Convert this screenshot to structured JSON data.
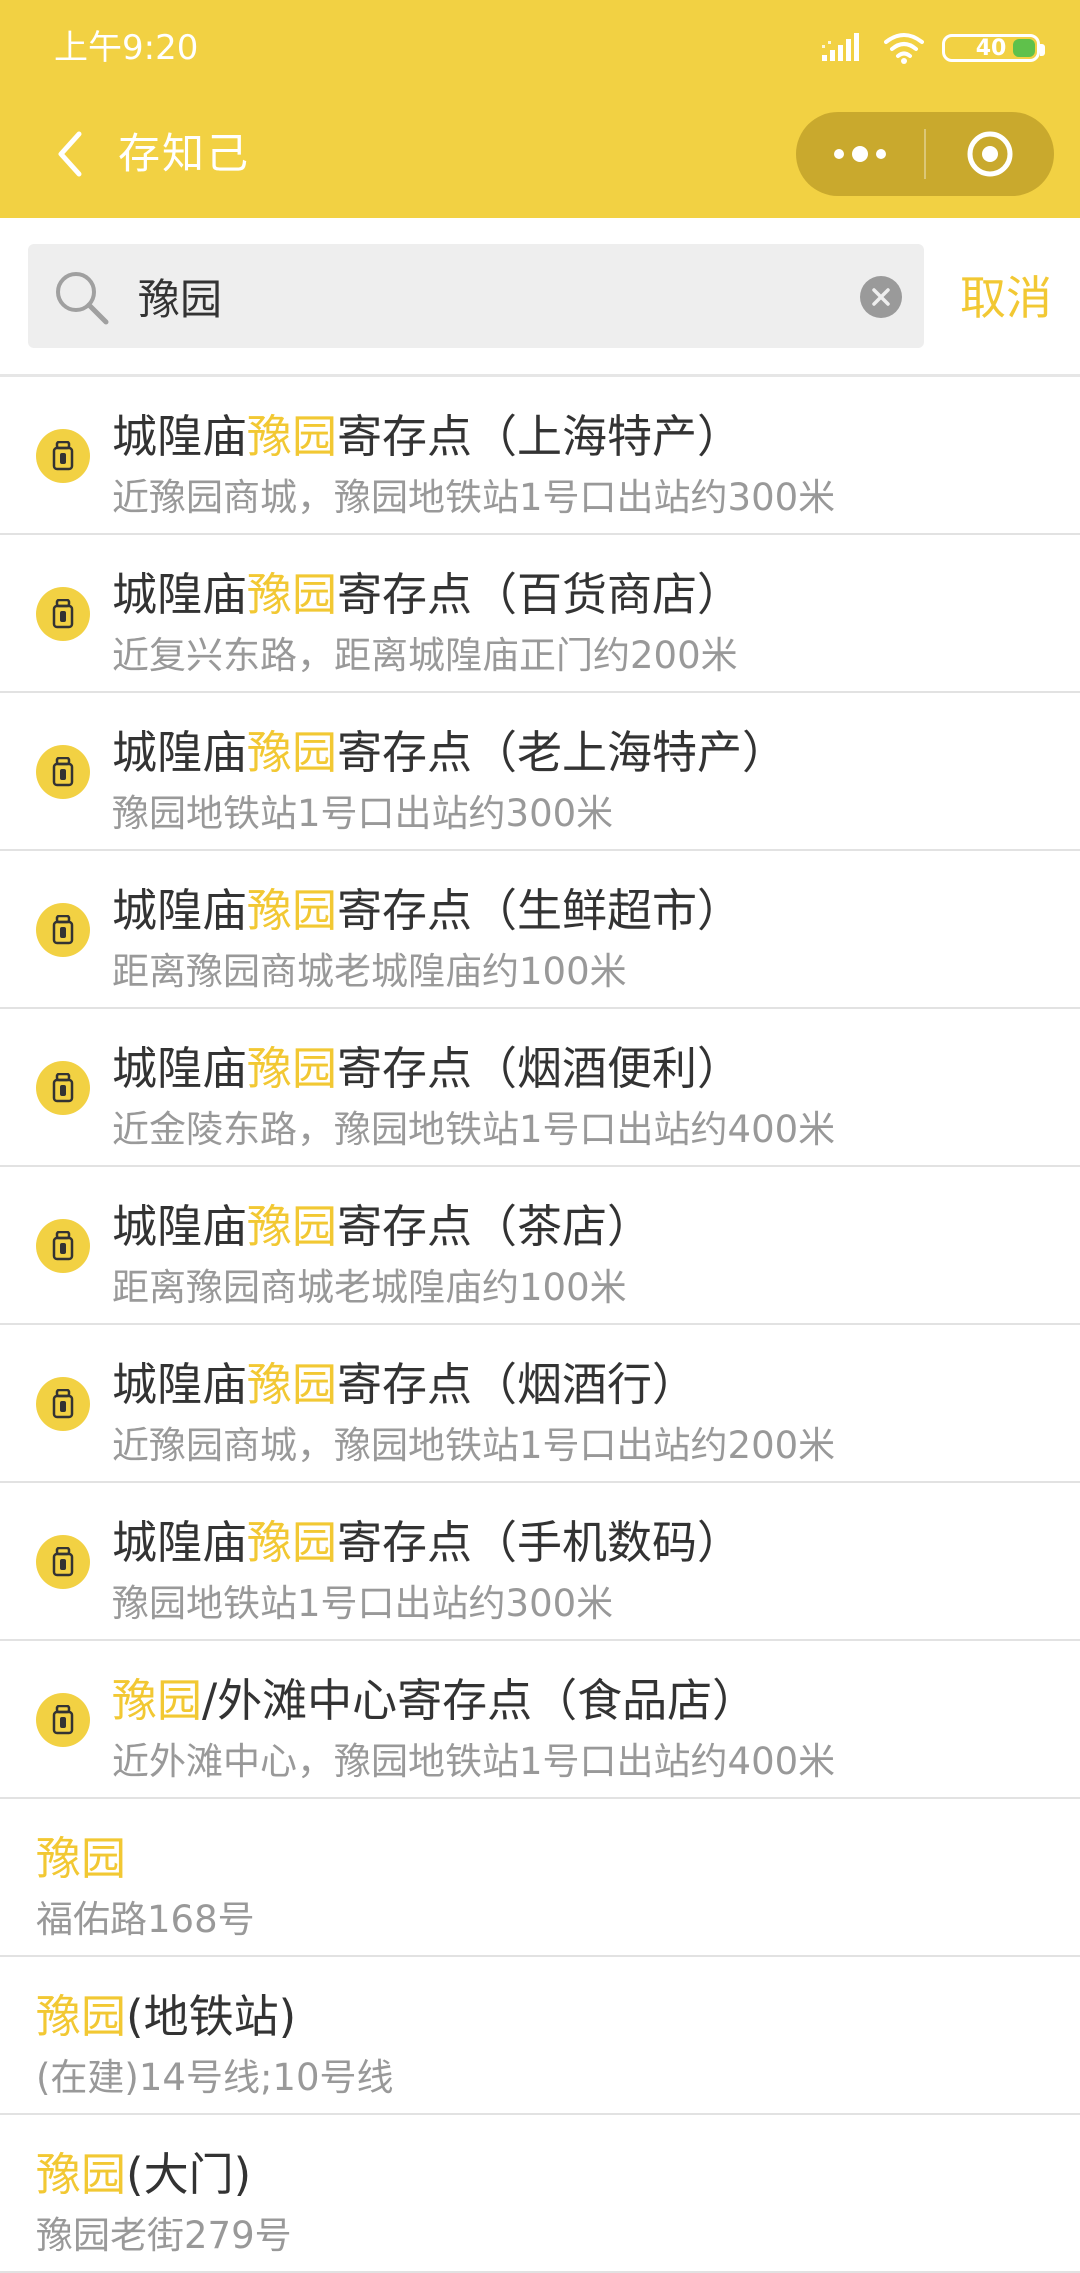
{
  "status": {
    "time": "上午9:20",
    "battery": "40"
  },
  "nav": {
    "title": "存知己"
  },
  "search": {
    "value": "豫园",
    "cancel_label": "取消"
  },
  "colors": {
    "brand": "#F2D143",
    "highlight": "#F2C833"
  },
  "results": [
    {
      "type": "storage",
      "pre": "城隍庙",
      "hl": "豫园",
      "post": "寄存点（上海特产）",
      "sub": "近豫园商城，豫园地铁站1号口出站约300米",
      "icon": "lock-icon"
    },
    {
      "type": "storage",
      "pre": "城隍庙",
      "hl": "豫园",
      "post": "寄存点（百货商店）",
      "sub": "近复兴东路，距离城隍庙正门约200米",
      "icon": "lock-icon"
    },
    {
      "type": "storage",
      "pre": "城隍庙",
      "hl": "豫园",
      "post": "寄存点（老上海特产）",
      "sub": "豫园地铁站1号口出站约300米",
      "icon": "lock-icon"
    },
    {
      "type": "storage",
      "pre": "城隍庙",
      "hl": "豫园",
      "post": "寄存点（生鲜超市）",
      "sub": "距离豫园商城老城隍庙约100米",
      "icon": "lock-icon"
    },
    {
      "type": "storage",
      "pre": "城隍庙",
      "hl": "豫园",
      "post": "寄存点（烟酒便利）",
      "sub": "近金陵东路，豫园地铁站1号口出站约400米",
      "icon": "lock-icon"
    },
    {
      "type": "storage",
      "pre": "城隍庙",
      "hl": "豫园",
      "post": "寄存点（茶店）",
      "sub": "距离豫园商城老城隍庙约100米",
      "icon": "lock-icon"
    },
    {
      "type": "storage",
      "pre": "城隍庙",
      "hl": "豫园",
      "post": "寄存点（烟酒行）",
      "sub": "近豫园商城，豫园地铁站1号口出站约200米",
      "icon": "lock-icon"
    },
    {
      "type": "storage",
      "pre": "城隍庙",
      "hl": "豫园",
      "post": "寄存点（手机数码）",
      "sub": "豫园地铁站1号口出站约300米",
      "icon": "lock-icon"
    },
    {
      "type": "storage",
      "pre": "",
      "hl": "豫园",
      "post": "/外滩中心寄存点（食品店）",
      "sub": "近外滩中心，豫园地铁站1号口出站约400米",
      "icon": "lock-icon"
    },
    {
      "type": "place",
      "pre": "",
      "hl": "豫园",
      "post": "",
      "sub": "福佑路168号"
    },
    {
      "type": "place",
      "pre": "",
      "hl": "豫园",
      "post": "(地铁站)",
      "sub": "(在建)14号线;10号线"
    },
    {
      "type": "place",
      "pre": "",
      "hl": "豫园",
      "post": "(大门)",
      "sub": "豫园老街279号"
    }
  ]
}
